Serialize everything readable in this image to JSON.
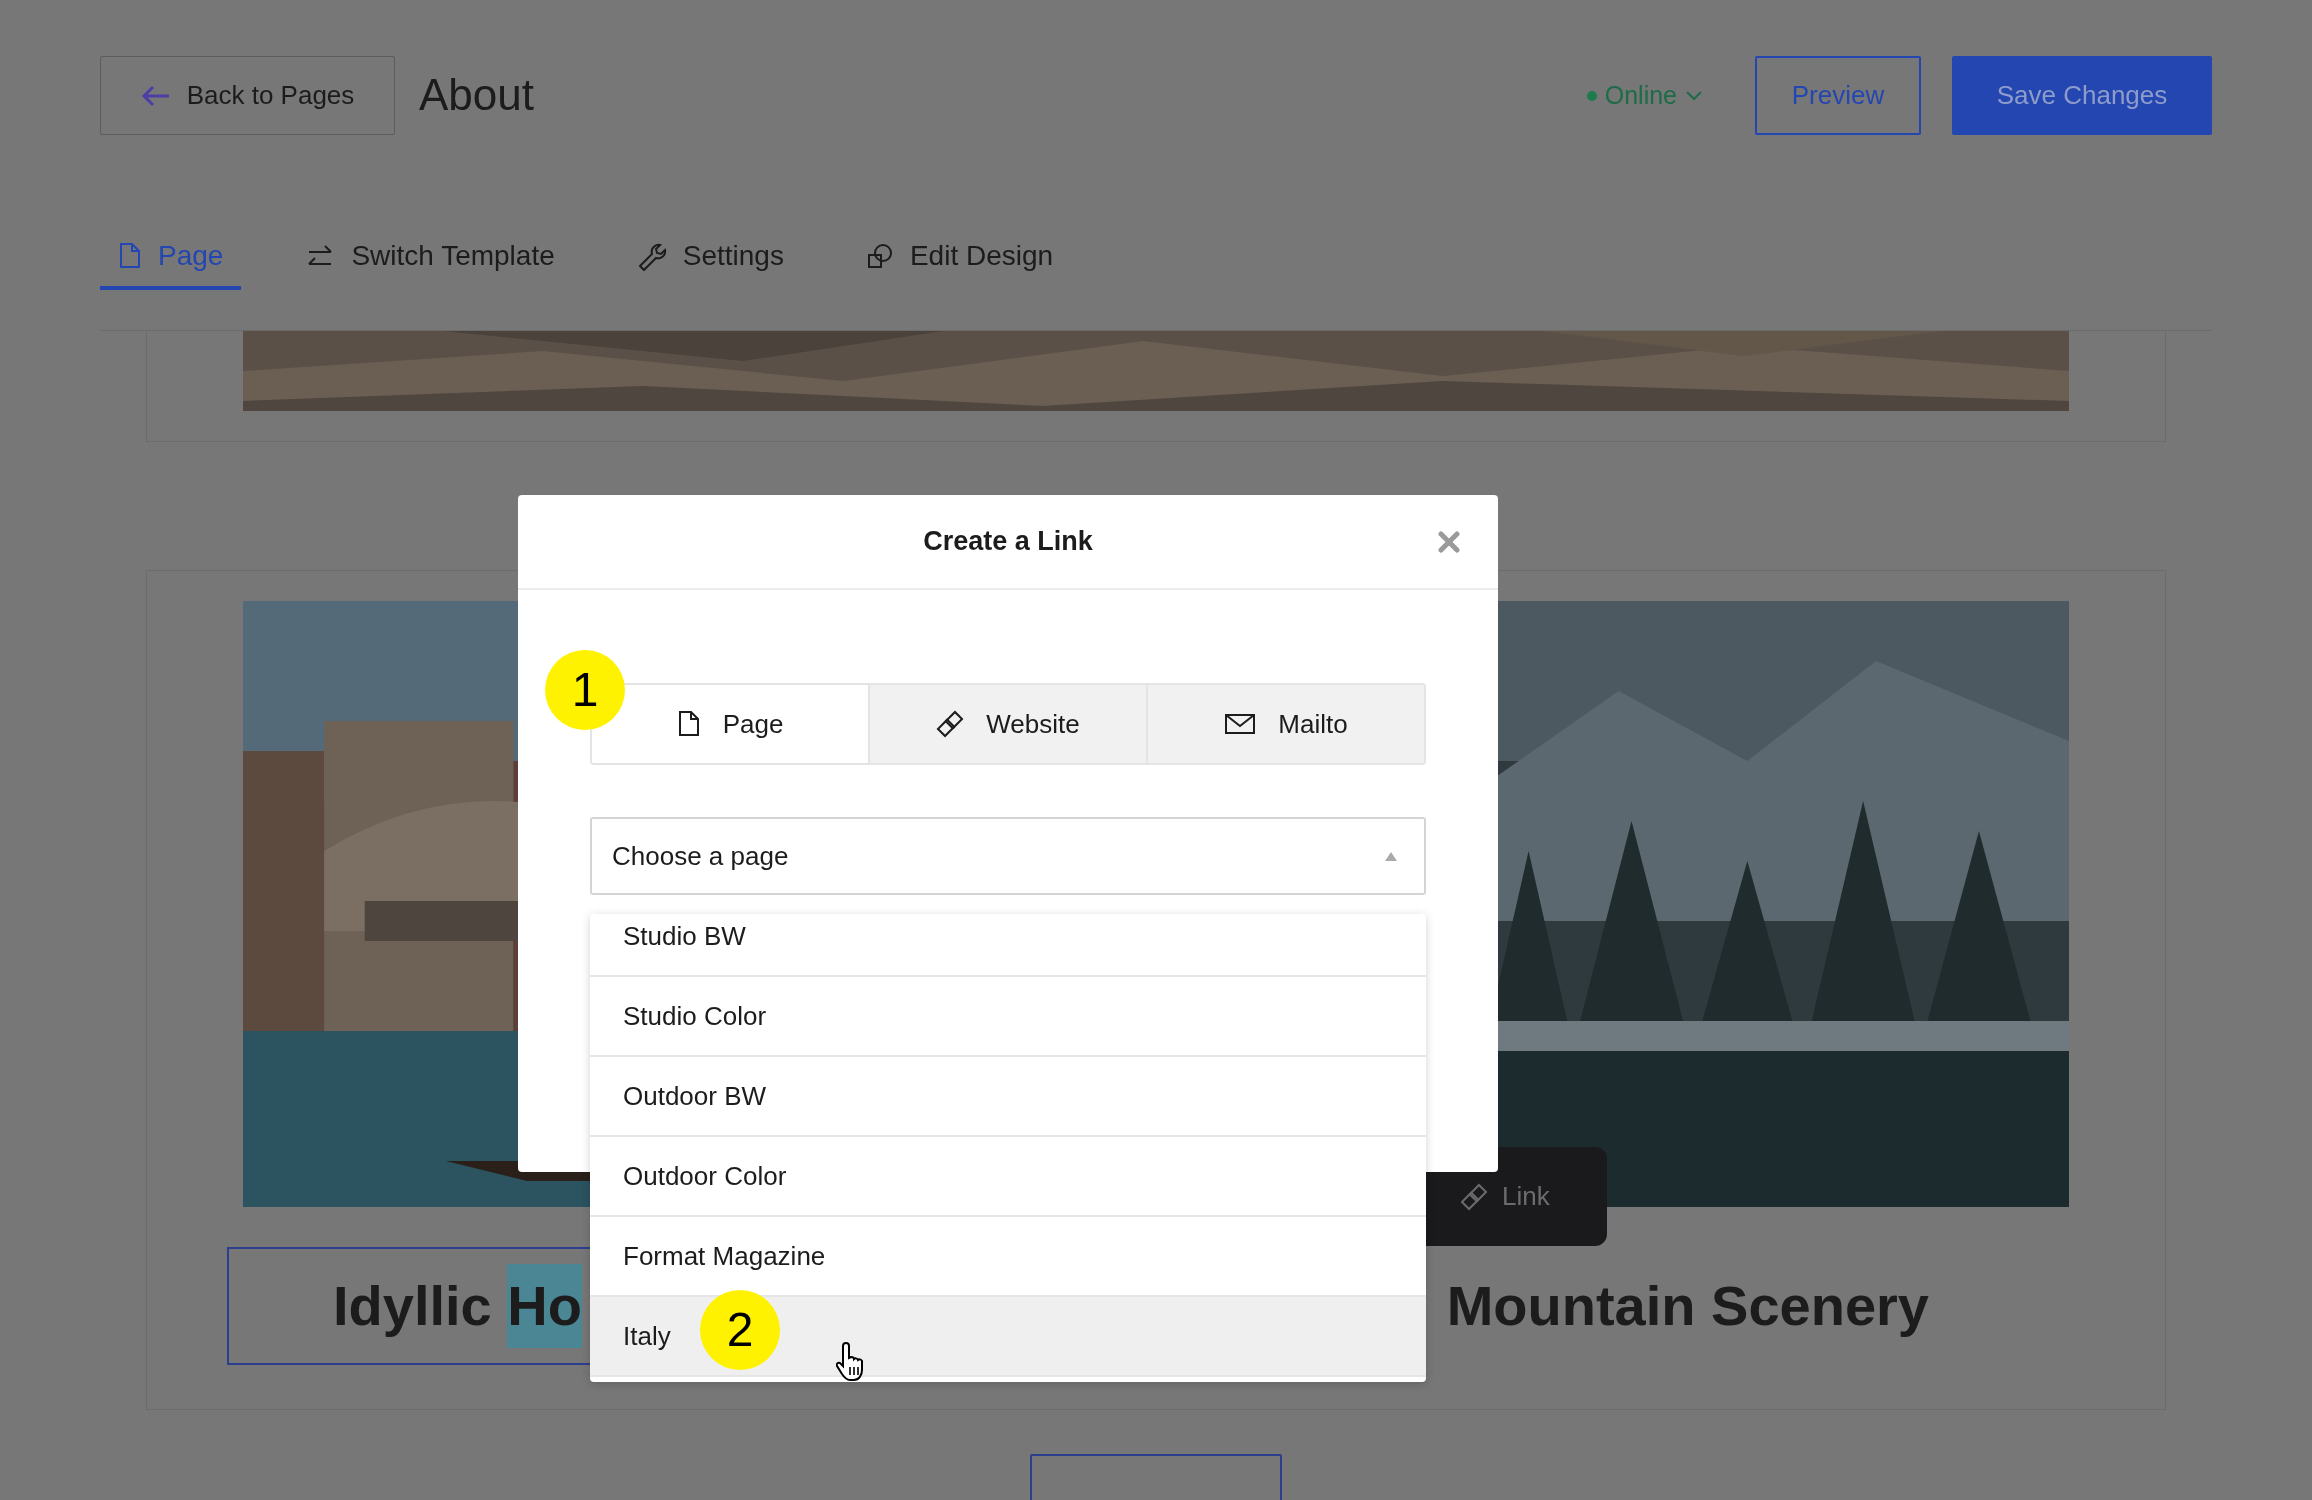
{
  "header": {
    "back_button": "Back to Pages",
    "title": "About",
    "status": "Online",
    "buttons": [
      {
        "label": "Preview",
        "kind": "outline"
      },
      {
        "label": "Save Changes",
        "kind": "primary"
      }
    ]
  },
  "tabs": [
    {
      "label": "Page",
      "selected": true
    },
    {
      "label": "Switch Template",
      "selected": false
    },
    {
      "label": "Settings",
      "selected": false
    },
    {
      "label": "Edit Design",
      "selected": false
    }
  ],
  "titles": [
    {
      "boxed": true,
      "parts": [
        {
          "text": "Idyllic ",
          "highlighted": false
        },
        {
          "text": "Ho",
          "highlighted": true
        }
      ]
    },
    {
      "boxed": false,
      "parts": [
        {
          "text": "Mountain Scenery",
          "highlighted": false
        }
      ]
    }
  ],
  "link_toolbar": {
    "label": "Link"
  },
  "modal": {
    "title": "Create a Link",
    "link_types": [
      {
        "label": "Page",
        "selected": true
      },
      {
        "label": "Website",
        "selected": false
      },
      {
        "label": "Mailto",
        "selected": false
      }
    ],
    "select": {
      "placeholder": "Choose a page",
      "expanded": true
    },
    "options": [
      {
        "label": "Studio BW",
        "hovered": false
      },
      {
        "label": "Studio Color",
        "hovered": false
      },
      {
        "label": "Outdoor BW",
        "hovered": false
      },
      {
        "label": "Outdoor Color",
        "hovered": false
      },
      {
        "label": "Format Magazine",
        "hovered": false
      },
      {
        "label": "Italy",
        "hovered": true
      }
    ]
  },
  "annotations": [
    {
      "label": "1"
    },
    {
      "label": "2"
    }
  ]
}
